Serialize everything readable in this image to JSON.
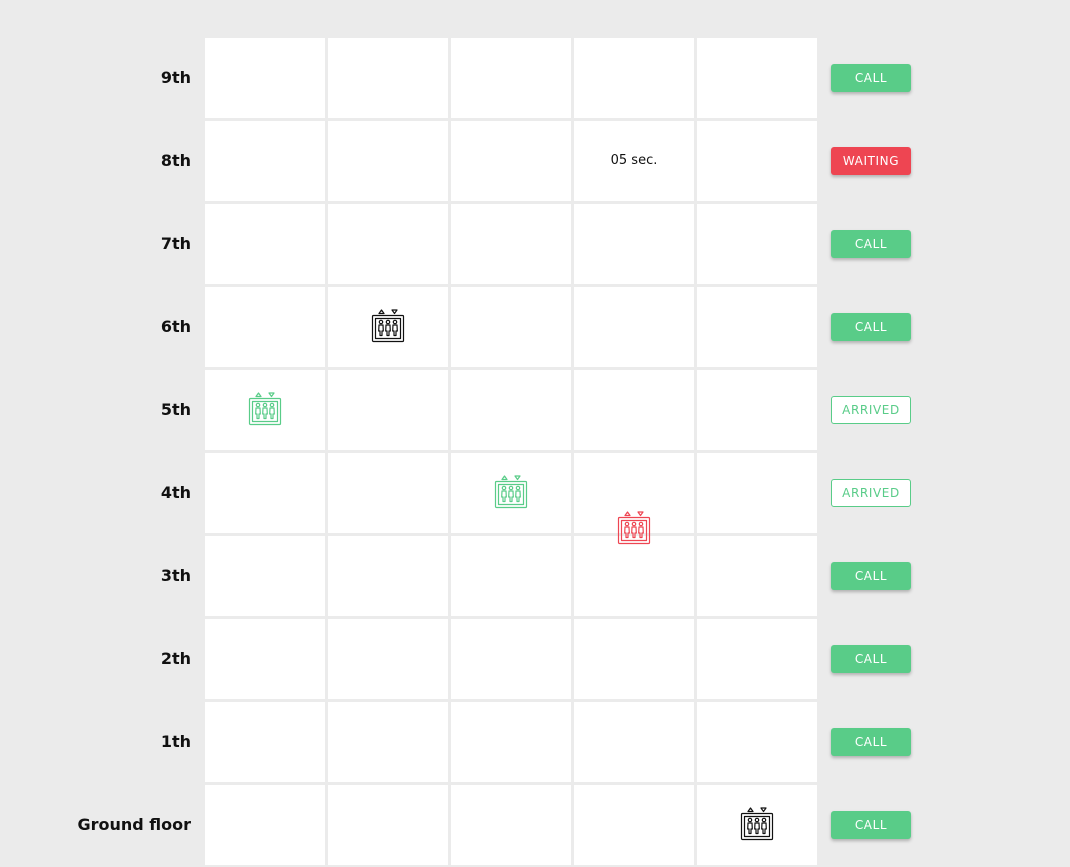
{
  "floors": [
    {
      "label": "9th",
      "button": "CALL",
      "state": "call"
    },
    {
      "label": "8th",
      "button": "WAITING",
      "state": "waiting",
      "timer": "05 sec.",
      "timer_shaft": 3
    },
    {
      "label": "7th",
      "button": "CALL",
      "state": "call"
    },
    {
      "label": "6th",
      "button": "CALL",
      "state": "call"
    },
    {
      "label": "5th",
      "button": "ARRIVED",
      "state": "arrived"
    },
    {
      "label": "4th",
      "button": "ARRIVED",
      "state": "arrived"
    },
    {
      "label": "3th",
      "button": "CALL",
      "state": "call"
    },
    {
      "label": "2th",
      "button": "CALL",
      "state": "call"
    },
    {
      "label": "1th",
      "button": "CALL",
      "state": "call"
    },
    {
      "label": "Ground floor",
      "button": "CALL",
      "state": "call"
    }
  ],
  "shafts": 5,
  "elevators": [
    {
      "shaft": 0,
      "floor": 5,
      "status": "arrived"
    },
    {
      "shaft": 1,
      "floor": 6,
      "status": "idle"
    },
    {
      "shaft": 2,
      "floor": 4,
      "status": "arrived"
    },
    {
      "shaft": 3,
      "floor": 3.57,
      "status": "moving"
    },
    {
      "shaft": 4,
      "floor": 0,
      "status": "idle"
    }
  ],
  "colors": {
    "idle": "#111111",
    "arrived": "#59cc88",
    "moving": "#ee4552",
    "call_button": "#59cc88",
    "waiting_button": "#ee4552",
    "cell": "#ffffff",
    "background": "#ebebeb"
  },
  "icons": {
    "elevator": "elevator-icon"
  }
}
